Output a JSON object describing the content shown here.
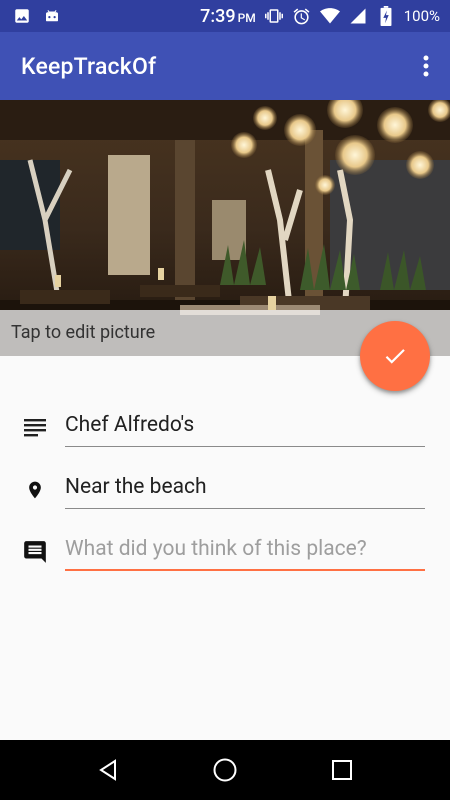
{
  "status_bar": {
    "time": "7:39",
    "ampm": "PM",
    "battery": "100%"
  },
  "app_bar": {
    "title": "KeepTrackOf"
  },
  "hero": {
    "caption": "Tap to edit picture"
  },
  "form": {
    "name_value": "Chef Alfredo's",
    "location_value": "Near the beach",
    "notes_placeholder": "What did you think of this place?"
  },
  "colors": {
    "primary": "#3f51b5",
    "primary_dark": "#303f9f",
    "accent": "#ff7043"
  }
}
